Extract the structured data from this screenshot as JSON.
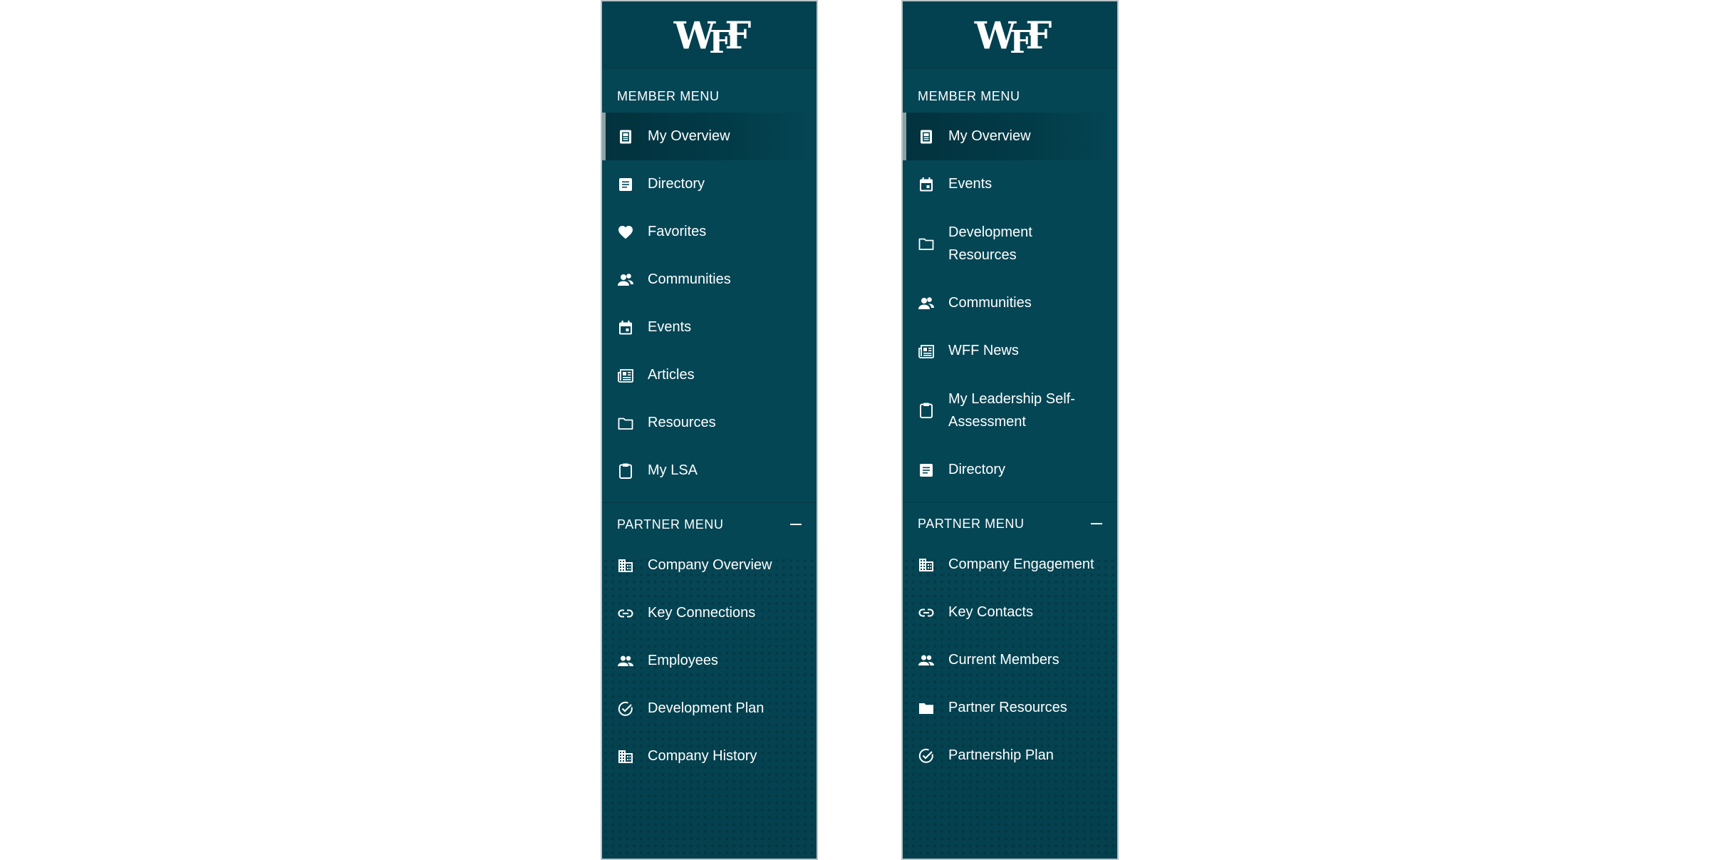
{
  "sidebars": [
    {
      "logo": "WFF",
      "member_menu": {
        "title": "MEMBER MENU",
        "items": [
          {
            "label": "My Overview",
            "icon": "overview-icon",
            "active": true
          },
          {
            "label": "Directory",
            "icon": "directory-icon"
          },
          {
            "label": "Favorites",
            "icon": "heart-icon"
          },
          {
            "label": "Communities",
            "icon": "communities-icon"
          },
          {
            "label": "Events",
            "icon": "calendar-icon"
          },
          {
            "label": "Articles",
            "icon": "newspaper-icon"
          },
          {
            "label": "Resources",
            "icon": "folder-outline-icon"
          },
          {
            "label": "My LSA",
            "icon": "clipboard-icon"
          }
        ]
      },
      "partner_menu": {
        "title": "PARTNER MENU",
        "collapse_symbol": "—",
        "items": [
          {
            "label": "Company Overview",
            "icon": "building-icon"
          },
          {
            "label": "Key Connections",
            "icon": "link-icon"
          },
          {
            "label": "Employees",
            "icon": "people-icon"
          },
          {
            "label": "Development Plan",
            "icon": "check-circle-icon"
          },
          {
            "label": "Company History",
            "icon": "building-icon"
          }
        ]
      }
    },
    {
      "logo": "WFF",
      "member_menu": {
        "title": "MEMBER MENU",
        "items": [
          {
            "label": "My Overview",
            "icon": "overview-icon",
            "active": true
          },
          {
            "label": "Events",
            "icon": "calendar-icon"
          },
          {
            "label": "Development Resources",
            "icon": "folder-outline-icon"
          },
          {
            "label": "Communities",
            "icon": "communities-icon"
          },
          {
            "label": "WFF News",
            "icon": "newspaper-icon"
          },
          {
            "label": "My Leadership Self-Assessment",
            "icon": "clipboard-icon"
          },
          {
            "label": "Directory",
            "icon": "directory-icon"
          }
        ]
      },
      "partner_menu": {
        "title": "PARTNER MENU",
        "collapse_symbol": "—",
        "items": [
          {
            "label": "Company Engagement",
            "icon": "building-icon"
          },
          {
            "label": "Key Contacts",
            "icon": "link-icon"
          },
          {
            "label": "Current Members",
            "icon": "people-icon"
          },
          {
            "label": "Partner Resources",
            "icon": "folder-filled-icon"
          },
          {
            "label": "Partnership Plan",
            "icon": "check-circle-icon"
          }
        ]
      }
    }
  ],
  "colors": {
    "sidebar_bg": "#054655",
    "logo_bar_bg": "#034150",
    "active_bg": "#02323d",
    "active_indicator": "#8aa3a7",
    "text": "#ffffff"
  }
}
